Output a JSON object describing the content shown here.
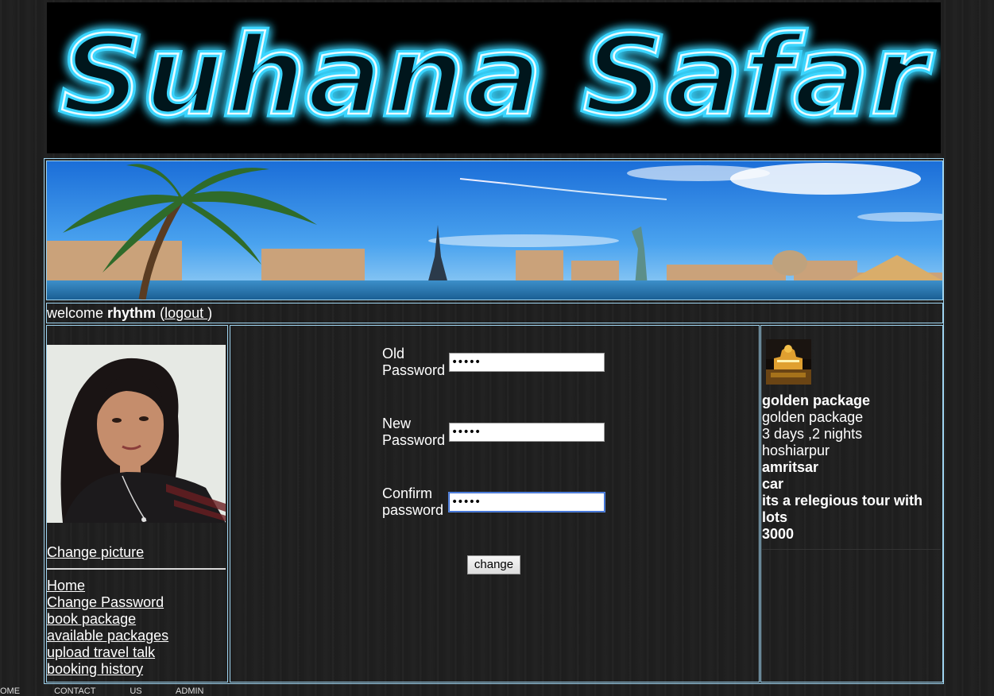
{
  "site": {
    "logo_text": "Suhana Safar"
  },
  "header": {
    "welcome_prefix": "welcome",
    "username": "rhythm",
    "logout_open": "(",
    "logout_label": "logout ",
    "logout_close": ")"
  },
  "sidebar": {
    "change_picture": "Change picture",
    "items": [
      {
        "label": "Home "
      },
      {
        "label": "Change Password"
      },
      {
        "label": "book package "
      },
      {
        "label": "available packages"
      },
      {
        "label": "upload travel talk"
      },
      {
        "label": "booking history"
      }
    ]
  },
  "form": {
    "old": {
      "label_1": "Old",
      "label_2": "Password",
      "value": "•••••"
    },
    "new": {
      "label_1": "New",
      "label_2": "Password",
      "value": "•••••"
    },
    "confirm": {
      "label_1": "Confirm",
      "label_2": "password",
      "value": "•••••"
    },
    "submit_label": "change"
  },
  "package": {
    "name_bold": "golden package",
    "name": "golden package",
    "duration": "3 days ,2 nights",
    "from": "hoshiarpur",
    "to": "amritsar",
    "transport": "car",
    "description": "its a relegious tour with lots",
    "price": "3000"
  },
  "footer": {
    "text": "OME CONTACT US ADMIN"
  },
  "colors": {
    "border": "#9fd4f0",
    "neon": "#39d2ff",
    "background": "#1f1f1f"
  }
}
